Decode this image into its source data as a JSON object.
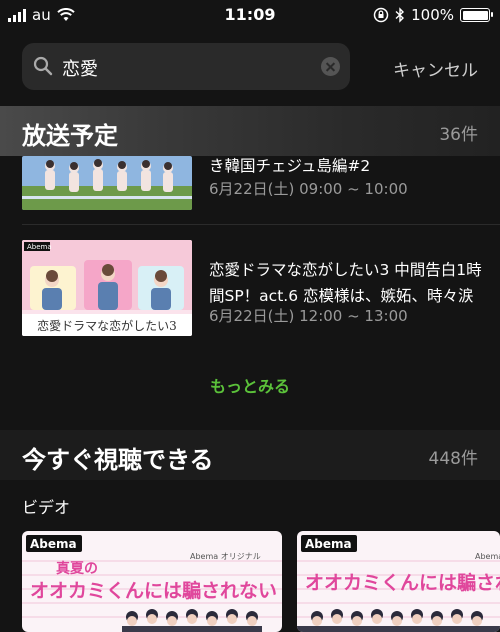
{
  "status": {
    "carrier": "au",
    "time": "11:09",
    "battery_percent": "100%",
    "battery_level": 1.0
  },
  "search": {
    "query": "恋愛",
    "cancel_label": "キャンセル"
  },
  "broadcast_section": {
    "title": "放送予定",
    "count": "36件",
    "items": [
      {
        "title": "き韓国チェジュ島編#2",
        "time": "6月22日(土) 09:00 ~ 10:00"
      },
      {
        "title_line1": "恋愛ドラマな恋がしたい3 中間告白1時",
        "title_line2": "間SP！act.6 恋模様は、嫉妬、時々涙",
        "time": "6月22日(土) 12:00 ~ 13:00",
        "thumb_logo": "Abema",
        "thumb_caption": "恋愛ドラマな恋がしたい3"
      }
    ],
    "more_label": "もっとみる"
  },
  "watch_section": {
    "title": "今すぐ視聴できる",
    "count": "448件",
    "video_label": "ビデオ",
    "cards": [
      {
        "logo": "Abema",
        "tag": "Abema オリジナル",
        "title_a": "真夏の",
        "title_b": "オオカミくんには騙されない"
      },
      {
        "logo": "Abema",
        "tag": "Abema",
        "title_b": "オオカミくんには騙される"
      }
    ]
  },
  "colors": {
    "background": "#141414",
    "accent_green": "#5bc13a",
    "pink": "#e0479c"
  }
}
